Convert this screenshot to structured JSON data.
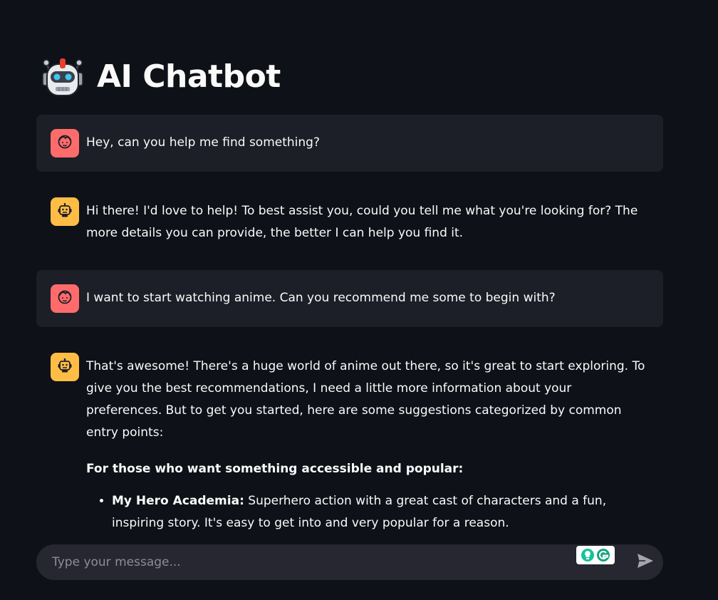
{
  "header": {
    "title": "AI Chatbot",
    "logo_icon": "robot-icon"
  },
  "colors": {
    "background": "#0e1117",
    "user_message_bg": "#1c1f27",
    "user_avatar": "#ff6b6b",
    "assistant_avatar": "#ffbd45",
    "input_bg": "#262730"
  },
  "messages": [
    {
      "role": "user",
      "avatar_icon": "user-face-icon",
      "text": "Hey, can you help me find something?"
    },
    {
      "role": "assistant",
      "avatar_icon": "bot-face-icon",
      "text": "Hi there! I'd love to help! To best assist you, could you tell me what you're looking for? The more details you can provide, the better I can help you find it."
    },
    {
      "role": "user",
      "avatar_icon": "user-face-icon",
      "text": "I want to start watching anime. Can you recommend me some to begin with?"
    },
    {
      "role": "assistant",
      "avatar_icon": "bot-face-icon",
      "intro": "That's awesome! There's a huge world of anime out there, so it's great to start exploring. To give you the best recommendations, I need a little more information about your preferences. But to get you started, here are some suggestions categorized by common entry points:",
      "section_heading": "For those who want something accessible and popular:",
      "items": [
        {
          "title": "My Hero Academia:",
          "description": " Superhero action with a great cast of characters and a fun, inspiring story. It's easy to get into and very popular for a reason."
        }
      ]
    }
  ],
  "input": {
    "placeholder": "Type your message...",
    "value": "",
    "send_icon": "send-icon",
    "extension_icon": "grammarly-icon"
  }
}
